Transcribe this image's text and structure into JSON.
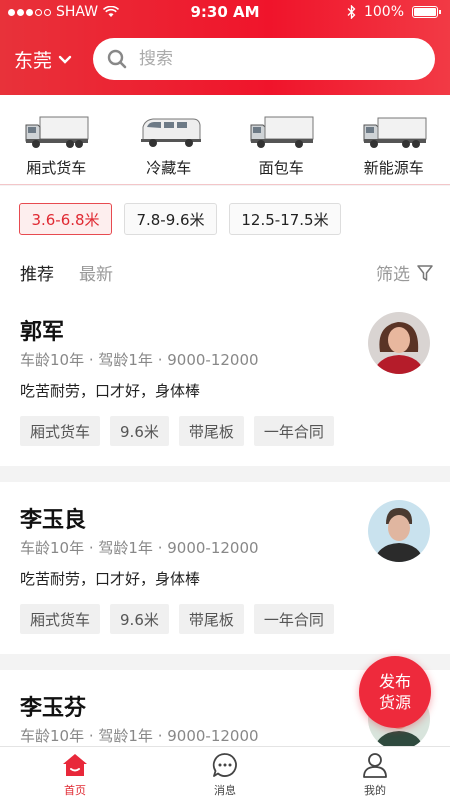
{
  "status_bar": {
    "carrier": "SHAW",
    "time": "9:30 AM",
    "battery": "100%"
  },
  "header": {
    "city": "东莞",
    "search_placeholder": "搜索"
  },
  "vehicle_types": [
    {
      "label": "厢式货车",
      "icon": "box-truck-icon"
    },
    {
      "label": "冷藏车",
      "icon": "van-icon"
    },
    {
      "label": "面包车",
      "icon": "box-truck-icon"
    },
    {
      "label": "新能源车",
      "icon": "box-truck-icon"
    }
  ],
  "size_filters": [
    {
      "label": "3.6-6.8米",
      "selected": true
    },
    {
      "label": "7.8-9.6米",
      "selected": false
    },
    {
      "label": "12.5-17.5米",
      "selected": false
    }
  ],
  "list_tabs": {
    "recommend": "推荐",
    "latest": "最新",
    "filter": "筛选"
  },
  "drivers": [
    {
      "name": "郭军",
      "meta": "车龄10年 · 驾龄1年 · 9000-12000",
      "desc": "吃苦耐劳，口才好，身体棒",
      "tags": [
        "厢式货车",
        "9.6米",
        "带尾板",
        "一年合同"
      ]
    },
    {
      "name": "李玉良",
      "meta": "车龄10年 · 驾龄1年 · 9000-12000",
      "desc": "吃苦耐劳，口才好，身体棒",
      "tags": [
        "厢式货车",
        "9.6米",
        "带尾板",
        "一年合同"
      ]
    },
    {
      "name": "李玉芬",
      "meta": "车龄10年 · 驾龄1年 · 9000-12000"
    }
  ],
  "fab": {
    "line1": "发布",
    "line2": "货源"
  },
  "tabbar": {
    "home": "首页",
    "messages": "消息",
    "mine": "我的"
  },
  "colors": {
    "brand": "#f0142b",
    "accent_text": "#e02a33"
  }
}
